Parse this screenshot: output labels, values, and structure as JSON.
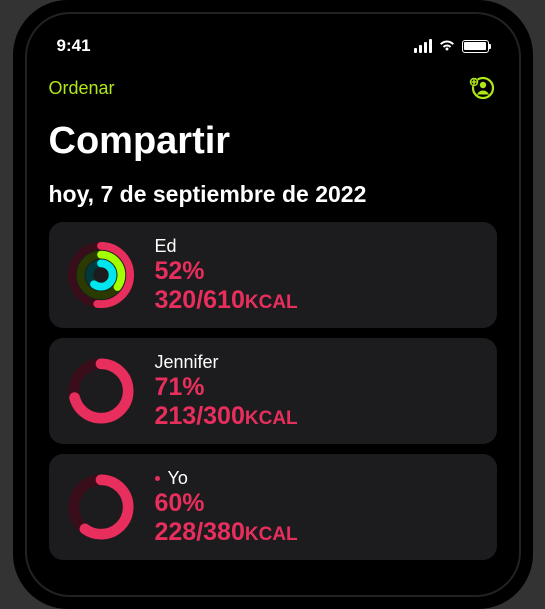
{
  "status": {
    "time": "9:41"
  },
  "nav": {
    "sort_label": "Ordenar"
  },
  "header": {
    "title": "Compartir",
    "date": "hoy, 7 de septiembre de 2022"
  },
  "activities": [
    {
      "name": "Ed",
      "percent": "52%",
      "calories_current": "320",
      "calories_goal": "610",
      "unit": "KCAL",
      "is_me": false,
      "ring_type": "triple",
      "move_progress": 0.52,
      "exercise_progress": 0.35,
      "stand_progress": 0.6
    },
    {
      "name": "Jennifer",
      "percent": "71%",
      "calories_current": "213",
      "calories_goal": "300",
      "unit": "KCAL",
      "is_me": false,
      "ring_type": "single",
      "move_progress": 0.71
    },
    {
      "name": "Yo",
      "percent": "60%",
      "calories_current": "228",
      "calories_goal": "380",
      "unit": "KCAL",
      "is_me": true,
      "ring_type": "single",
      "move_progress": 0.6
    }
  ],
  "colors": {
    "accent": "#b0e817",
    "move": "#e82e5c",
    "exercise": "#a4ff00",
    "stand": "#00e6ef"
  }
}
